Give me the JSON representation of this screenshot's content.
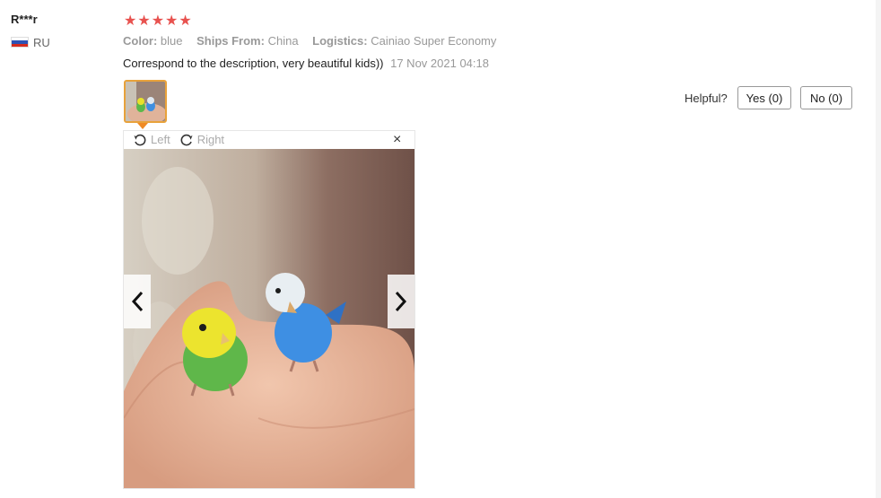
{
  "review": {
    "user": "R***r",
    "country": "RU",
    "stars": "★★★★★",
    "rating": 5,
    "color_label": "Color:",
    "color_value": "blue",
    "ships_label": "Ships From:",
    "ships_value": "China",
    "logistics_label": "Logistics:",
    "logistics_value": "Cainiao Super Economy",
    "text": "Correspond to the description, very beautiful kids))",
    "date": "17 Nov 2021 04:18"
  },
  "helpful": {
    "label": "Helpful?",
    "yes_label": "Yes (0)",
    "no_label": "No (0)"
  },
  "viewer": {
    "rotate_left_label": "Left",
    "rotate_right_label": "Right",
    "close_glyph": "×"
  },
  "colors": {
    "star": "#e8524f",
    "thumb_border": "#e8a23b"
  }
}
